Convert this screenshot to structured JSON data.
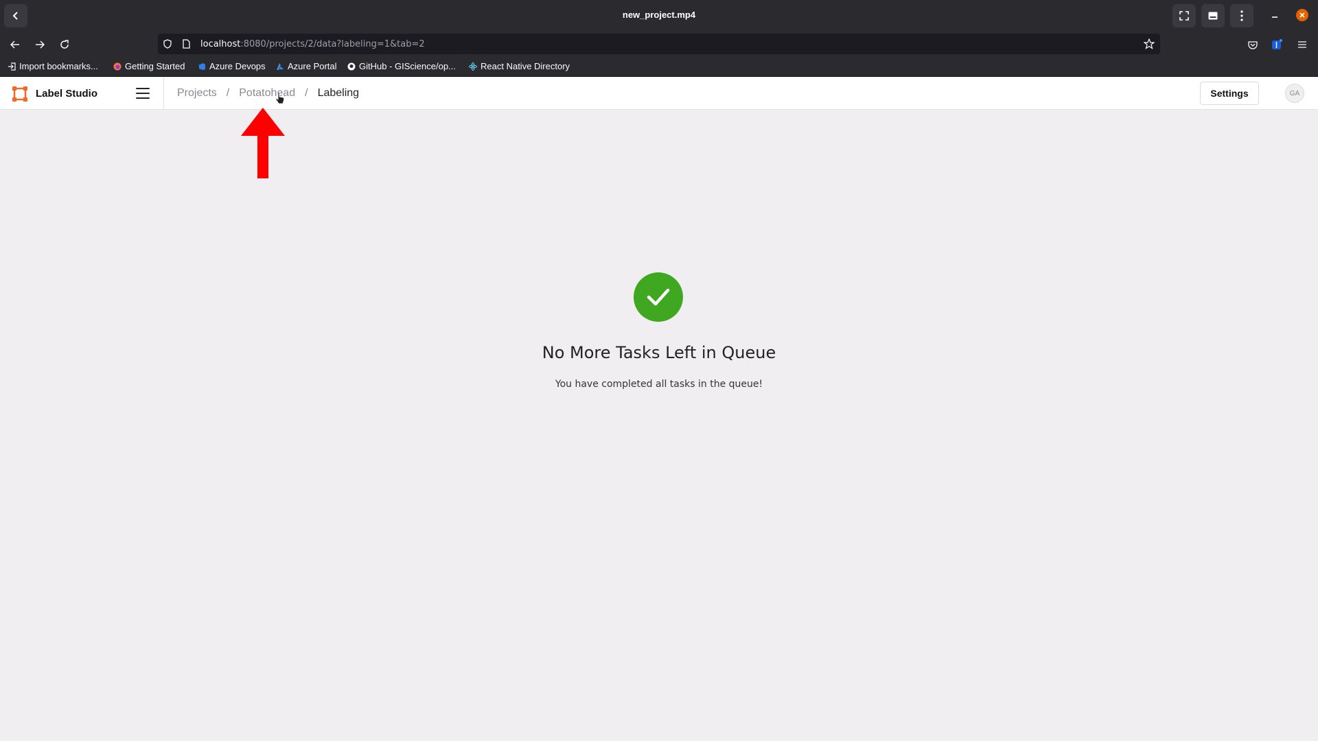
{
  "window": {
    "title": "new_project.mp4"
  },
  "browser": {
    "url_host": "localhost",
    "url_rest": ":8080/projects/2/data?labeling=1&tab=2"
  },
  "bookmarks": [
    {
      "label": "Import bookmarks...",
      "icon": "import-icon"
    },
    {
      "label": "Getting Started",
      "icon": "firefox-icon"
    },
    {
      "label": "Azure Devops",
      "icon": "azure-devops-icon"
    },
    {
      "label": "Azure Portal",
      "icon": "azure-icon"
    },
    {
      "label": "GitHub - GIScience/op...",
      "icon": "github-icon"
    },
    {
      "label": "React Native Directory",
      "icon": "react-icon"
    }
  ],
  "app": {
    "brand": "Label Studio",
    "breadcrumb": [
      "Projects",
      "/",
      "Potatohead",
      "/",
      "Labeling"
    ],
    "settings_label": "Settings",
    "avatar_initials": "GA"
  },
  "main": {
    "heading": "No More Tasks Left in Queue",
    "subtext": "You have completed all tasks in the queue!"
  },
  "colors": {
    "success": "#40a820",
    "accent": "#f06a2c",
    "annotation_arrow": "#ff0000"
  }
}
